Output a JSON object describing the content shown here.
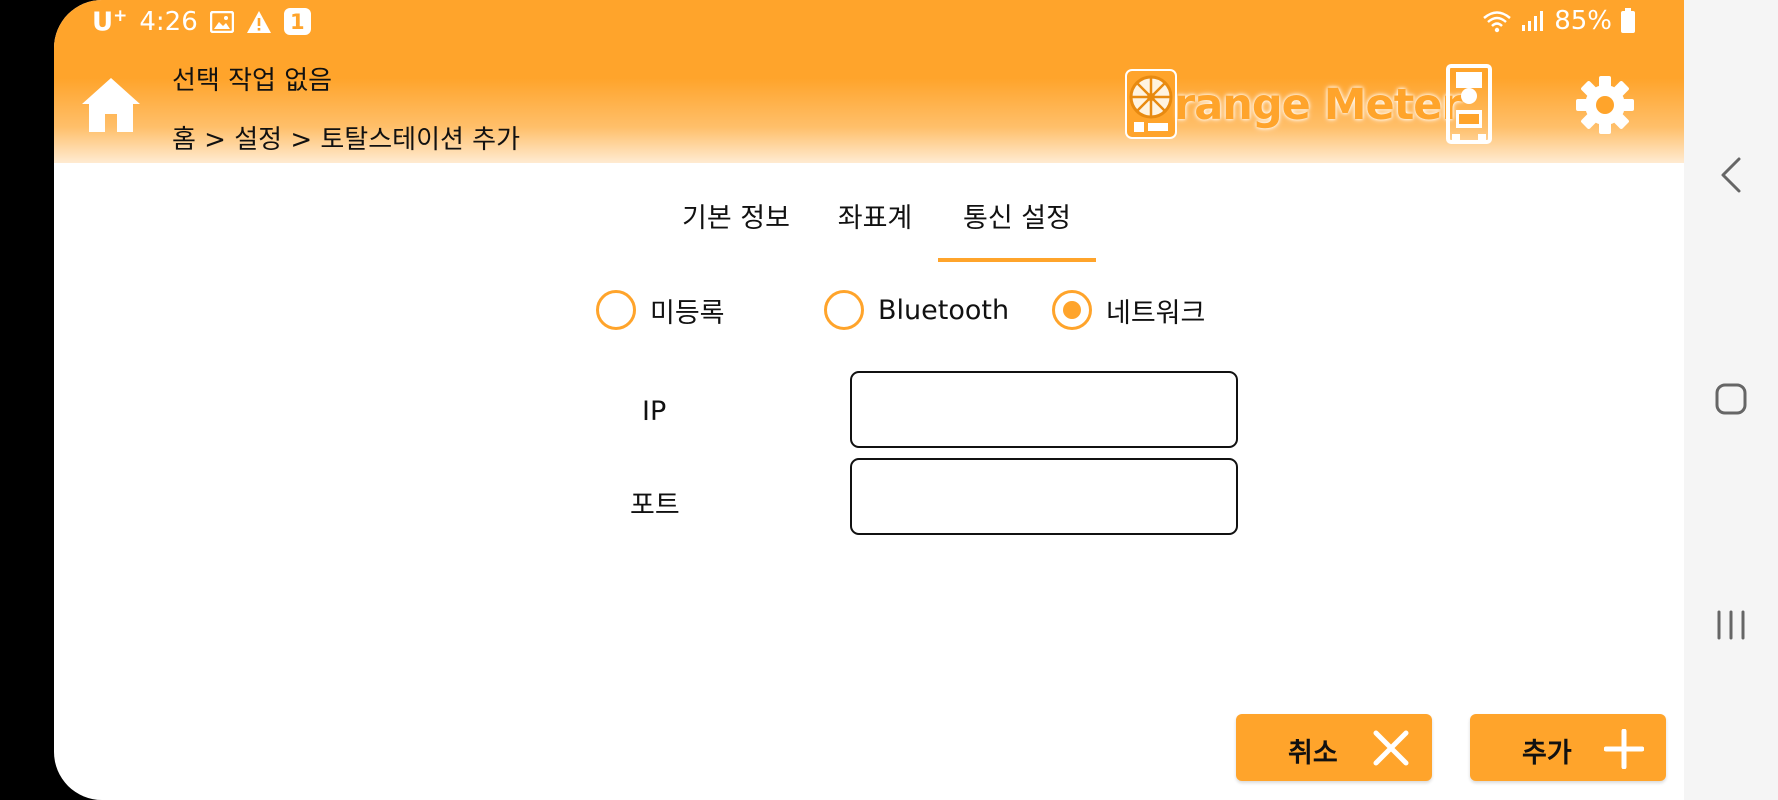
{
  "status_bar": {
    "carrier": "U",
    "carrier_sup": "+",
    "time": "4:26",
    "notification_count": "1",
    "battery": "85%"
  },
  "header": {
    "title": "선택 작업 없음",
    "breadcrumb": "홈 > 설정 > 토탈스테이션 추가",
    "logo_text": "range Meter"
  },
  "tabs": [
    {
      "label": "기본 정보",
      "active": false
    },
    {
      "label": "좌표계",
      "active": false
    },
    {
      "label": "통신 설정",
      "active": true
    }
  ],
  "connection_options": [
    {
      "label": "미등록",
      "selected": false
    },
    {
      "label": "Bluetooth",
      "selected": false
    },
    {
      "label": "네트워크",
      "selected": true
    }
  ],
  "fields": {
    "ip_label": "IP",
    "ip_value": "",
    "port_label": "포트",
    "port_value": ""
  },
  "buttons": {
    "cancel_label": "취소",
    "add_label": "추가"
  },
  "colors": {
    "accent": "#FFA42B"
  }
}
